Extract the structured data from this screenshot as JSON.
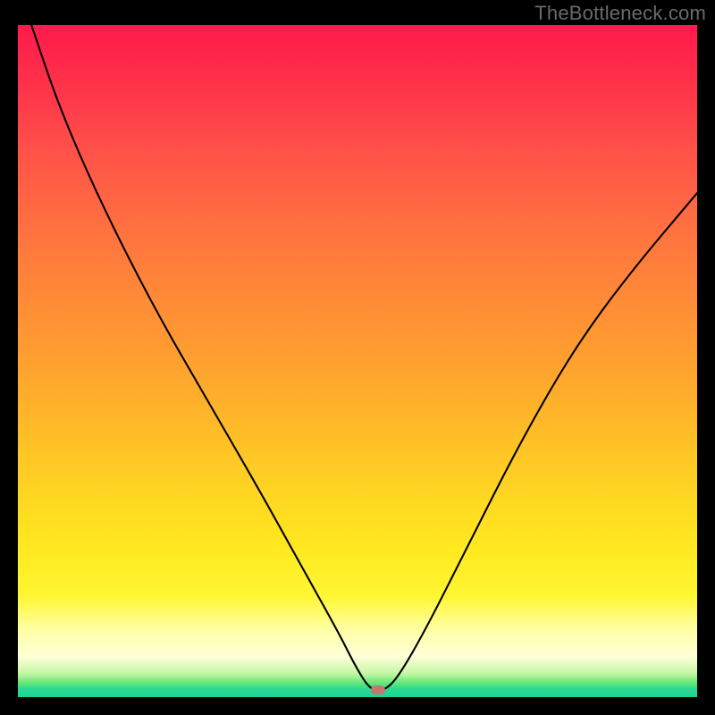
{
  "watermark": "TheBottleneck.com",
  "chart_data": {
    "type": "line",
    "title": "",
    "xlabel": "",
    "ylabel": "",
    "xlim": [
      0,
      100
    ],
    "ylim": [
      0,
      100
    ],
    "grid": false,
    "series": [
      {
        "name": "bottleneck-curve",
        "x": [
          2,
          6,
          12,
          20,
          28,
          36,
          42,
          47,
          50,
          52,
          54,
          56,
          60,
          66,
          74,
          82,
          90,
          100
        ],
        "values": [
          100,
          88,
          74,
          58,
          44,
          30,
          19,
          10,
          4,
          1,
          1,
          3,
          10,
          22,
          38,
          52,
          63,
          75
        ]
      }
    ],
    "annotations": [
      {
        "name": "min-marker",
        "x": 53,
        "y": 1
      }
    ]
  }
}
